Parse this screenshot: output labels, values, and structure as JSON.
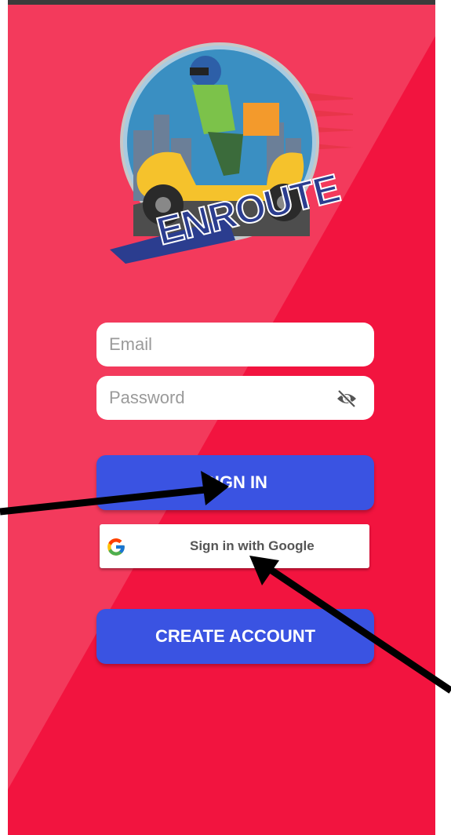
{
  "logo": {
    "wordmark": "ENROUTE",
    "icon": "scooter-delivery-icon"
  },
  "form": {
    "email_placeholder": "Email",
    "password_placeholder": "Password",
    "password_toggle_icon": "eye-off-icon"
  },
  "buttons": {
    "sign_in_label": "SIGN IN",
    "google_label": "Sign in with Google",
    "google_icon": "google-g-icon",
    "create_account_label": "CREATE ACCOUNT"
  },
  "colors": {
    "background": "#f2143f",
    "primary_button": "#3a53e2",
    "logo_text": "#2b3d8f"
  }
}
